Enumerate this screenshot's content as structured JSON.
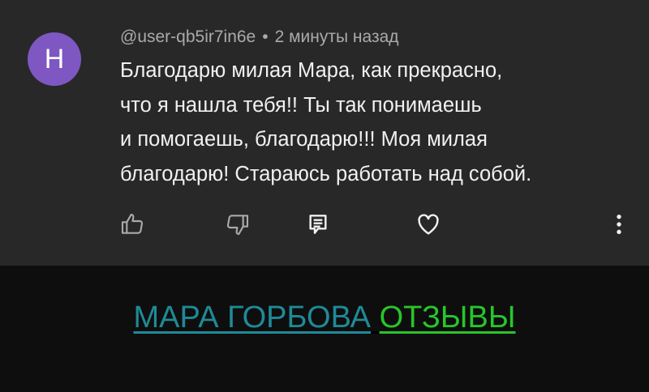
{
  "comment": {
    "avatar_letter": "H",
    "author": "@user-qb5ir7in6e",
    "separator": "•",
    "time": "2 минуты назад",
    "lines": [
      "Благодарю милая Мара, как прекрасно,",
      "что я нашла тебя!! Ты так понимаешь",
      "и помогаешь, благодарю!!! Моя милая",
      "благодарю! Стараюсь работать над собой."
    ]
  },
  "actions": {
    "icons": [
      "thumbs-up-icon",
      "thumbs-down-icon",
      "reply-icon",
      "heart-icon",
      "more-vertical-icon"
    ]
  },
  "banner": {
    "part1": "МАРА ГОРБОВА",
    "part2": "ОТЗЫВЫ",
    "colors": {
      "part1": "#1f8a97",
      "part2": "#27c62a"
    }
  }
}
